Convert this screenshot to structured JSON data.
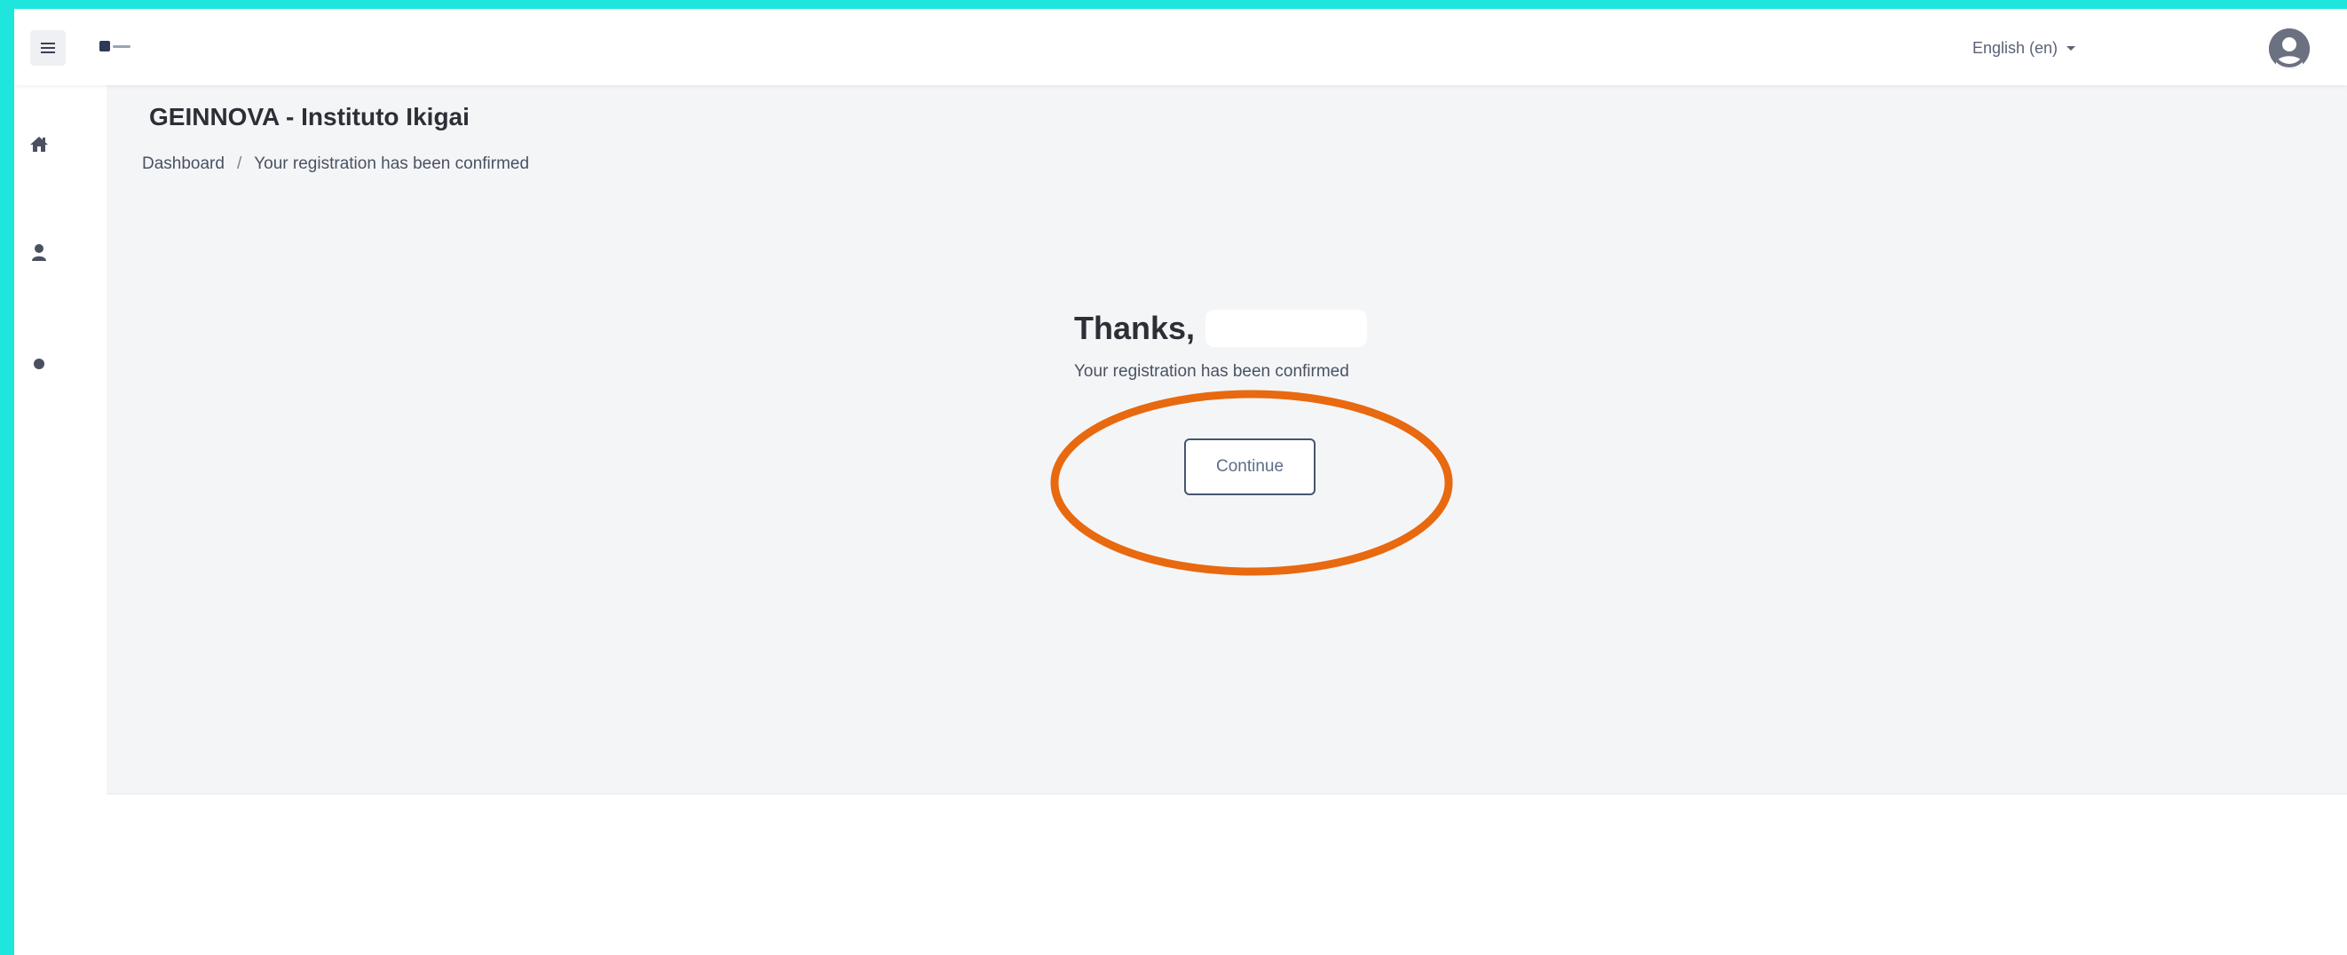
{
  "header": {
    "menu_icon": "hamburger-icon",
    "logo": "site-logo",
    "language_label": "English (en)",
    "user_avatar": "user-avatar-icon"
  },
  "rail": {
    "items": [
      {
        "icon": "home-icon"
      },
      {
        "icon": "user-icon"
      },
      {
        "icon": "dot-icon"
      }
    ]
  },
  "page": {
    "title": "GEINNOVA - Instituto Ikigai",
    "breadcrumb": {
      "home": "Dashboard",
      "separator": "/",
      "current": "Your registration has been confirmed"
    }
  },
  "notice": {
    "thanks": "Thanks,",
    "message": "Your registration has been confirmed",
    "continue_label": "Continue"
  },
  "annotation": {
    "highlight_color": "#e8690f"
  },
  "colors": {
    "border_accent": "#1fe6dc",
    "panel_bg": "#f4f5f7",
    "button_border": "#46566f"
  }
}
